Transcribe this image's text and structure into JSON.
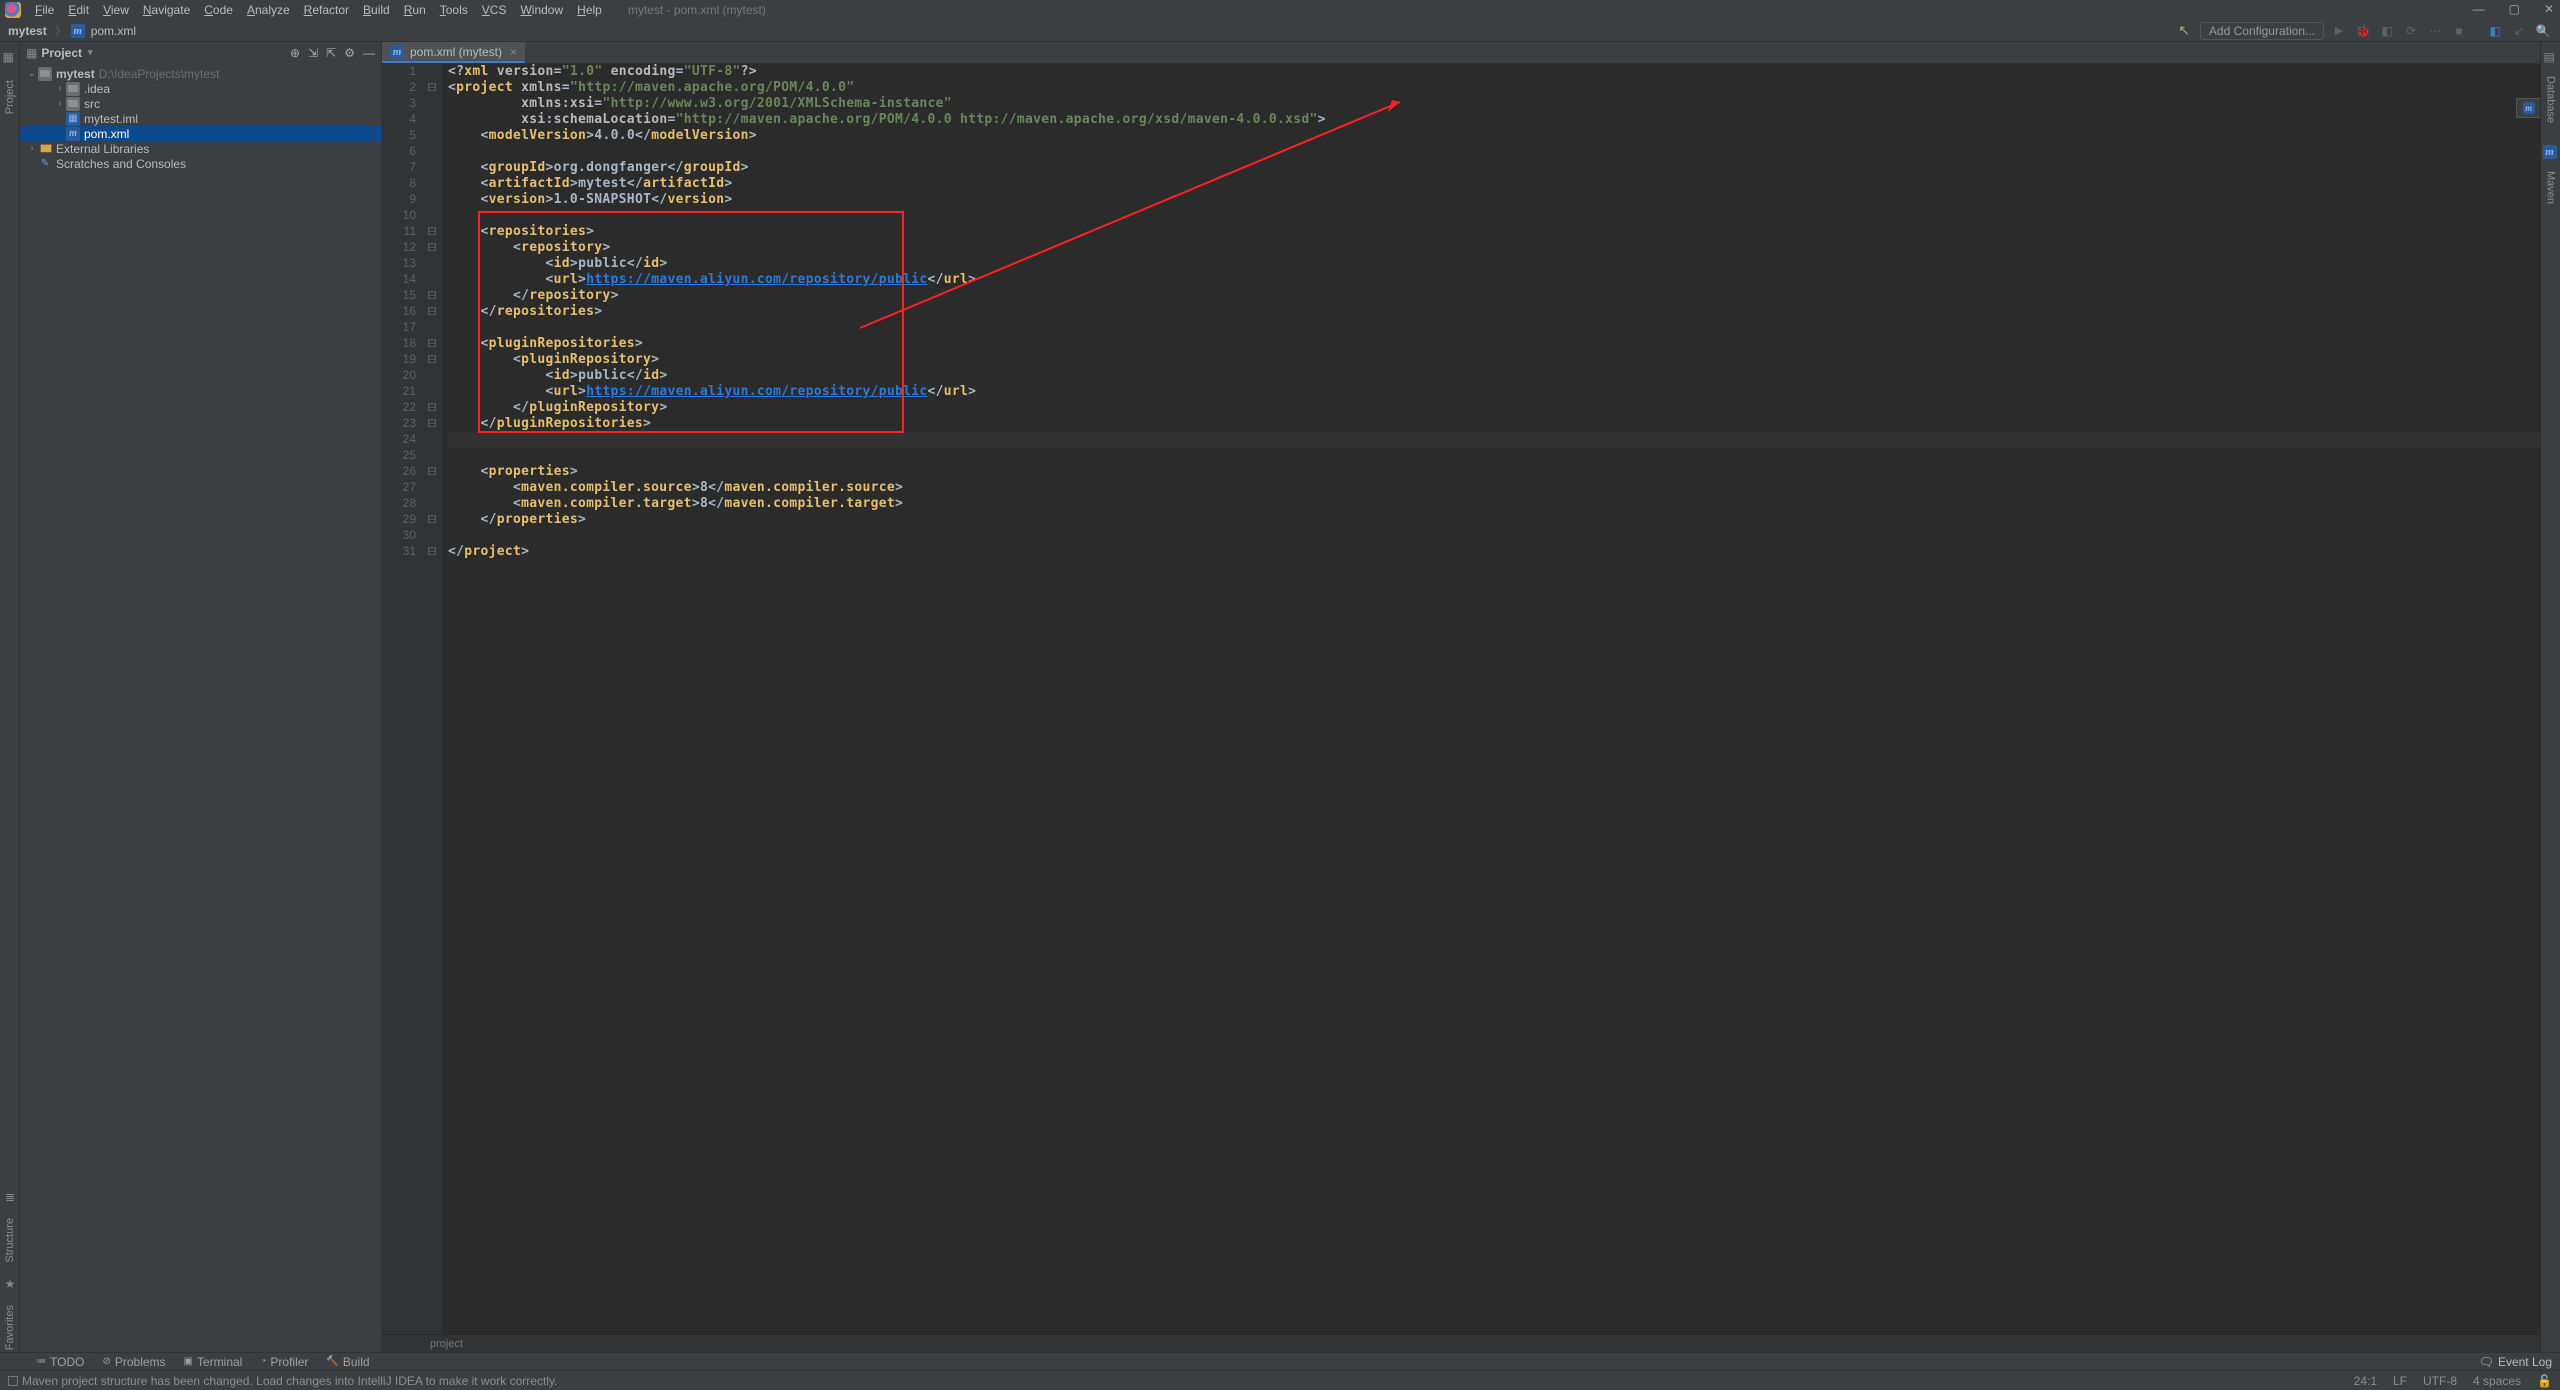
{
  "window_title": "mytest - pom.xml (mytest)",
  "menu": [
    "File",
    "Edit",
    "View",
    "Navigate",
    "Code",
    "Analyze",
    "Refactor",
    "Build",
    "Run",
    "Tools",
    "VCS",
    "Window",
    "Help"
  ],
  "breadcrumb": {
    "root": "mytest",
    "file": "pom.xml"
  },
  "add_config": "Add Configuration...",
  "project_label": "Project",
  "tree": {
    "root": {
      "name": "mytest",
      "path": "D:\\IdeaProjects\\mytest"
    },
    "items": [
      {
        "name": ".idea",
        "kind": "folder",
        "twisty": "closed",
        "indent": 2
      },
      {
        "name": "src",
        "kind": "folder",
        "twisty": "closed",
        "indent": 2
      },
      {
        "name": "mytest.iml",
        "kind": "iml",
        "twisty": "none",
        "indent": 2
      },
      {
        "name": "pom.xml",
        "kind": "maven",
        "twisty": "none",
        "indent": 2,
        "selected": true
      }
    ],
    "ext_lib": "External Libraries",
    "scratches": "Scratches and Consoles"
  },
  "editor_tab": "pom.xml (mytest)",
  "code": [
    {
      "n": 1,
      "fold": "",
      "t": [
        [
          "pi",
          "<?"
        ],
        [
          "tag",
          "xml "
        ],
        [
          "attr",
          "version"
        ],
        [
          "eq",
          "="
        ],
        [
          "val",
          "\"1.0\" "
        ],
        [
          "attr",
          "encoding"
        ],
        [
          "eq",
          "="
        ],
        [
          "val",
          "\"UTF-8\""
        ],
        [
          "pi",
          "?>"
        ]
      ]
    },
    {
      "n": 2,
      "fold": "⊟",
      "t": [
        [
          "txt",
          "<"
        ],
        [
          "tag",
          "project "
        ],
        [
          "attr",
          "xmlns"
        ],
        [
          "eq",
          "="
        ],
        [
          "val",
          "\"http://maven.apache.org/POM/4.0.0\""
        ]
      ]
    },
    {
      "n": 3,
      "fold": "",
      "t": [
        [
          "txt",
          "         "
        ],
        [
          "attr",
          "xmlns:"
        ],
        [
          "attr",
          "xsi"
        ],
        [
          "eq",
          "="
        ],
        [
          "val",
          "\"http://www.w3.org/2001/XMLSchema-instance\""
        ]
      ]
    },
    {
      "n": 4,
      "fold": "",
      "t": [
        [
          "txt",
          "         "
        ],
        [
          "attr",
          "xsi"
        ],
        [
          "txt",
          ":"
        ],
        [
          "attr",
          "schemaLocation"
        ],
        [
          "eq",
          "="
        ],
        [
          "val",
          "\"http://maven.apache.org/POM/4.0.0 http://maven.apache.org/xsd/maven-4.0.0.xsd\""
        ],
        [
          "txt",
          ">"
        ]
      ]
    },
    {
      "n": 5,
      "fold": "",
      "t": [
        [
          "txt",
          "    <"
        ],
        [
          "tag",
          "modelVersion"
        ],
        [
          "txt",
          ">"
        ],
        [
          "txt",
          "4.0.0"
        ],
        [
          "txt",
          "</"
        ],
        [
          "tag",
          "modelVersion"
        ],
        [
          "txt",
          ">"
        ]
      ]
    },
    {
      "n": 6,
      "fold": "",
      "t": []
    },
    {
      "n": 7,
      "fold": "",
      "t": [
        [
          "txt",
          "    <"
        ],
        [
          "tag",
          "groupId"
        ],
        [
          "txt",
          ">"
        ],
        [
          "txt",
          "org.dongfanger"
        ],
        [
          "txt",
          "</"
        ],
        [
          "tag",
          "groupId"
        ],
        [
          "txt",
          ">"
        ]
      ]
    },
    {
      "n": 8,
      "fold": "",
      "t": [
        [
          "txt",
          "    <"
        ],
        [
          "tag",
          "artifactId"
        ],
        [
          "txt",
          ">"
        ],
        [
          "txt",
          "mytest"
        ],
        [
          "txt",
          "</"
        ],
        [
          "tag",
          "artifactId"
        ],
        [
          "txt",
          ">"
        ]
      ]
    },
    {
      "n": 9,
      "fold": "",
      "t": [
        [
          "txt",
          "    <"
        ],
        [
          "tag",
          "version"
        ],
        [
          "txt",
          ">"
        ],
        [
          "txt",
          "1.0-SNAPSHOT"
        ],
        [
          "txt",
          "</"
        ],
        [
          "tag",
          "version"
        ],
        [
          "txt",
          ">"
        ]
      ]
    },
    {
      "n": 10,
      "fold": "",
      "t": []
    },
    {
      "n": 11,
      "fold": "⊟",
      "t": [
        [
          "txt",
          "    <"
        ],
        [
          "tag",
          "repositories"
        ],
        [
          "txt",
          ">"
        ]
      ]
    },
    {
      "n": 12,
      "fold": "⊟",
      "t": [
        [
          "txt",
          "        <"
        ],
        [
          "tag",
          "repository"
        ],
        [
          "txt",
          ">"
        ]
      ]
    },
    {
      "n": 13,
      "fold": "",
      "t": [
        [
          "txt",
          "            <"
        ],
        [
          "tag",
          "id"
        ],
        [
          "txt",
          ">"
        ],
        [
          "txt",
          "public"
        ],
        [
          "txt",
          "</"
        ],
        [
          "tag",
          "id"
        ],
        [
          "txt",
          ">"
        ]
      ]
    },
    {
      "n": 14,
      "fold": "",
      "t": [
        [
          "txt",
          "            <"
        ],
        [
          "tag",
          "url"
        ],
        [
          "txt",
          ">"
        ],
        [
          "url",
          "https://maven.aliyun.com/repository/public"
        ],
        [
          "txt",
          "</"
        ],
        [
          "tag",
          "url"
        ],
        [
          "txt",
          ">"
        ]
      ]
    },
    {
      "n": 15,
      "fold": "⊟",
      "t": [
        [
          "txt",
          "        </"
        ],
        [
          "tag",
          "repository"
        ],
        [
          "txt",
          ">"
        ]
      ]
    },
    {
      "n": 16,
      "fold": "⊟",
      "t": [
        [
          "txt",
          "    </"
        ],
        [
          "tag",
          "repositories"
        ],
        [
          "txt",
          ">"
        ]
      ]
    },
    {
      "n": 17,
      "fold": "",
      "t": []
    },
    {
      "n": 18,
      "fold": "⊟",
      "t": [
        [
          "txt",
          "    <"
        ],
        [
          "tag",
          "pluginRepositories"
        ],
        [
          "txt",
          ">"
        ]
      ]
    },
    {
      "n": 19,
      "fold": "⊟",
      "t": [
        [
          "txt",
          "        <"
        ],
        [
          "tag",
          "pluginRepository"
        ],
        [
          "txt",
          ">"
        ]
      ]
    },
    {
      "n": 20,
      "fold": "",
      "t": [
        [
          "txt",
          "            <"
        ],
        [
          "tag",
          "id"
        ],
        [
          "txt",
          ">"
        ],
        [
          "txt",
          "public"
        ],
        [
          "txt",
          "</"
        ],
        [
          "tag",
          "id"
        ],
        [
          "txt",
          ">"
        ]
      ]
    },
    {
      "n": 21,
      "fold": "",
      "t": [
        [
          "txt",
          "            <"
        ],
        [
          "tag",
          "url"
        ],
        [
          "txt",
          ">"
        ],
        [
          "url",
          "https://maven.aliyun.com/repository/public"
        ],
        [
          "txt",
          "</"
        ],
        [
          "tag",
          "url"
        ],
        [
          "txt",
          ">"
        ]
      ]
    },
    {
      "n": 22,
      "fold": "⊟",
      "t": [
        [
          "txt",
          "        </"
        ],
        [
          "tag",
          "pluginRepository"
        ],
        [
          "txt",
          ">"
        ]
      ]
    },
    {
      "n": 23,
      "fold": "⊟",
      "t": [
        [
          "txt",
          "    </"
        ],
        [
          "tag",
          "pluginRepositories"
        ],
        [
          "txt",
          ">"
        ]
      ]
    },
    {
      "n": 24,
      "fold": "",
      "t": [],
      "current": true
    },
    {
      "n": 25,
      "fold": "",
      "t": []
    },
    {
      "n": 26,
      "fold": "⊟",
      "t": [
        [
          "txt",
          "    <"
        ],
        [
          "tag",
          "properties"
        ],
        [
          "txt",
          ">"
        ]
      ]
    },
    {
      "n": 27,
      "fold": "",
      "t": [
        [
          "txt",
          "        <"
        ],
        [
          "tag",
          "maven.compiler.source"
        ],
        [
          "txt",
          ">"
        ],
        [
          "txt",
          "8"
        ],
        [
          "txt",
          "</"
        ],
        [
          "tag",
          "maven.compiler.source"
        ],
        [
          "txt",
          ">"
        ]
      ]
    },
    {
      "n": 28,
      "fold": "",
      "t": [
        [
          "txt",
          "        <"
        ],
        [
          "tag",
          "maven.compiler.target"
        ],
        [
          "txt",
          ">"
        ],
        [
          "txt",
          "8"
        ],
        [
          "txt",
          "</"
        ],
        [
          "tag",
          "maven.compiler.target"
        ],
        [
          "txt",
          ">"
        ]
      ]
    },
    {
      "n": 29,
      "fold": "⊟",
      "t": [
        [
          "txt",
          "    </"
        ],
        [
          "tag",
          "properties"
        ],
        [
          "txt",
          ">"
        ]
      ]
    },
    {
      "n": 30,
      "fold": "",
      "t": []
    },
    {
      "n": 31,
      "fold": "⊟",
      "t": [
        [
          "txt",
          "</"
        ],
        [
          "tag",
          "project"
        ],
        [
          "txt",
          ">"
        ]
      ]
    }
  ],
  "editor_crumb": "project",
  "left_tools_top": [
    "Project"
  ],
  "left_tools_bottom": [
    "Structure",
    "Favorites"
  ],
  "right_tools": [
    "Database",
    "Maven"
  ],
  "bottom_tools": [
    "TODO",
    "Problems",
    "Terminal",
    "Profiler",
    "Build"
  ],
  "event_log": "Event Log",
  "status_msg": "Maven project structure has been changed. Load changes into IntelliJ IDEA to make it work correctly.",
  "status_right": {
    "pos": "24:1",
    "sep": "LF",
    "enc": "UTF-8",
    "indent": "4 spaces"
  }
}
